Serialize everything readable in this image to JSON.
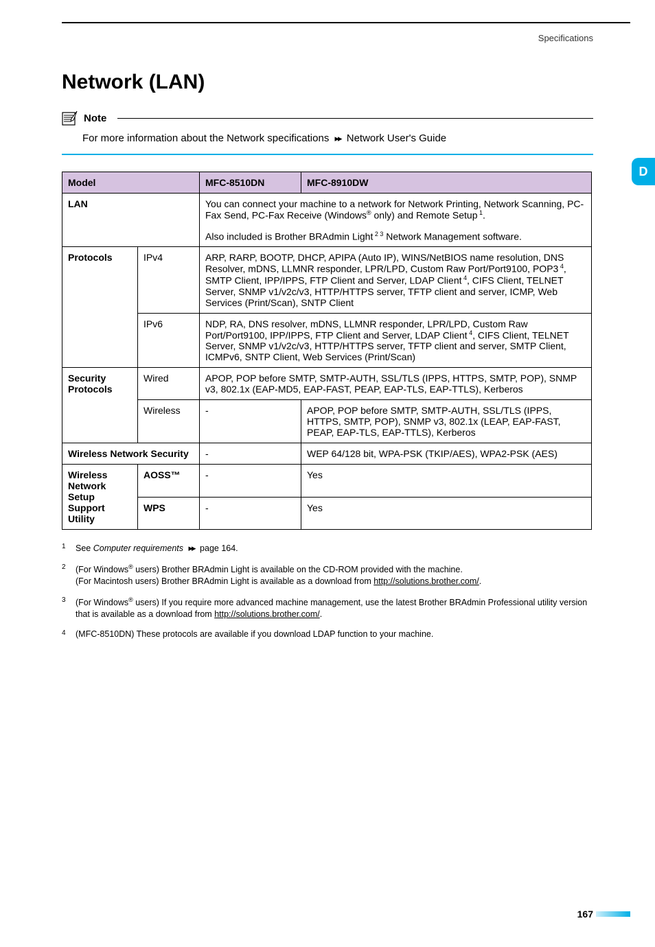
{
  "header": {
    "label": "Specifications"
  },
  "title": "Network (LAN)",
  "side_tab": "D",
  "note": {
    "label": "Note",
    "text_a": "For more information about the Network specifications ",
    "text_b": " Network User's Guide"
  },
  "table": {
    "head": {
      "model": "Model",
      "c1": "MFC-8510DN",
      "c2": "MFC-8910DW"
    },
    "lan": {
      "label": "LAN",
      "line1a": "You can connect your machine to a network for Network Printing, Network Scanning, PC-Fax Send, PC-Fax Receive (Windows",
      "line1b": " only) and Remote Setup",
      "sup_reg": "®",
      "sup_1": " 1",
      "period": ".",
      "line2a": "Also included is Brother BRAdmin Light",
      "sup_23": " 2 3",
      "line2b": " Network Management software."
    },
    "protocols": {
      "label": "Protocols",
      "ipv4_label": "IPv4",
      "ipv4_a": "ARP, RARP, BOOTP, DHCP, APIPA (Auto IP), WINS/NetBIOS name resolution, DNS Resolver, mDNS, LLMNR responder, LPR/LPD, Custom Raw Port/Port9100, POP3",
      "sup_4a": " 4",
      "ipv4_b": ", SMTP Client, IPP/IPPS, FTP Client and Server, LDAP Client",
      "sup_4b": " 4",
      "ipv4_c": ", CIFS Client, TELNET Server, SNMP v1/v2c/v3, HTTP/HTTPS server, TFTP client and server, ICMP, Web Services (Print/Scan), SNTP Client",
      "ipv6_label": "IPv6",
      "ipv6_a": "NDP, RA, DNS resolver, mDNS, LLMNR responder, LPR/LPD, Custom Raw Port/Port9100, IPP/IPPS, FTP Client and Server, LDAP Client",
      "sup_4c": " 4",
      "ipv6_b": ", CIFS Client, TELNET Server, SNMP v1/v2c/v3, HTTP/HTTPS server, TFTP client and server, SMTP Client, ICMPv6, SNTP Client, Web Services (Print/Scan)"
    },
    "security": {
      "label": "Security Protocols",
      "wired_label": "Wired",
      "wired_text": "APOP, POP before SMTP, SMTP-AUTH, SSL/TLS (IPPS, HTTPS, SMTP, POP), SNMP v3, 802.1x (EAP-MD5, EAP-FAST, PEAP, EAP-TLS, EAP-TTLS), Kerberos",
      "wireless_label": "Wireless",
      "wireless_c1": "-",
      "wireless_c2": "APOP, POP before SMTP, SMTP-AUTH, SSL/TLS (IPPS, HTTPS, SMTP, POP), SNMP v3, 802.1x (LEAP, EAP-FAST, PEAP, EAP-TLS, EAP-TTLS), Kerberos"
    },
    "wns": {
      "label": "Wireless Network Security",
      "c1": "-",
      "c2": "WEP 64/128 bit, WPA-PSK (TKIP/AES), WPA2-PSK (AES)"
    },
    "wsup": {
      "label": "Wireless Network Setup Support Utility",
      "aoss_label": "AOSS™",
      "aoss_c1": "-",
      "aoss_c2": "Yes",
      "wps_label": "WPS",
      "wps_c1": "-",
      "wps_c2": "Yes"
    }
  },
  "footnotes": {
    "f1": {
      "num": "1",
      "a": "See ",
      "italic": "Computer requirements",
      "b": " page 164."
    },
    "f2": {
      "num": "2",
      "line1a": "(For Windows",
      "reg": "®",
      "line1b": " users) Brother BRAdmin Light is available on the CD-ROM provided with the machine.",
      "line2": "(For Macintosh users) Brother BRAdmin Light is available as a download from ",
      "link": "http://solutions.brother.com/",
      "period": "."
    },
    "f3": {
      "num": "3",
      "a": "(For Windows",
      "reg": "®",
      "b": " users) If you require more advanced machine management, use the latest Brother BRAdmin Professional utility version that is available as a download from ",
      "link": "http://solutions.brother.com/",
      "period": "."
    },
    "f4": {
      "num": "4",
      "text": "(MFC-8510DN) These protocols are available if you download LDAP function to your machine."
    }
  },
  "page_number": "167"
}
